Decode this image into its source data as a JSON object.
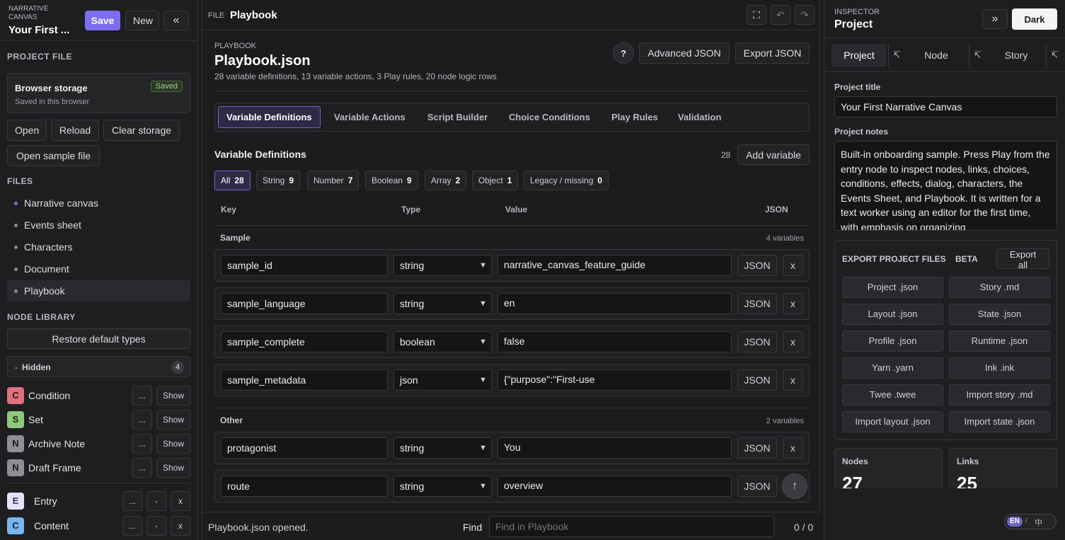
{
  "left": {
    "brand_sub": "NARRATIVE CANVAS",
    "brand_title": "Your First ...",
    "save_label": "Save",
    "new_label": "New",
    "collapse_glyph": "«",
    "project_file_title": "PROJECT FILE",
    "storage_title": "Browser storage",
    "storage_sub": "Saved in this browser",
    "saved_badge": "Saved",
    "open_label": "Open",
    "reload_label": "Reload",
    "clear_label": "Clear storage",
    "open_sample_label": "Open sample file",
    "files_title": "FILES",
    "files": [
      {
        "label": "Narrative canvas",
        "dot": "#7c6cf0"
      },
      {
        "label": "Events sheet",
        "dot": "#8a8a90"
      },
      {
        "label": "Characters",
        "dot": "#8a8a90"
      },
      {
        "label": "Document",
        "dot": "#8a8a90"
      },
      {
        "label": "Playbook",
        "dot": "#8a8a90"
      }
    ],
    "node_library_title": "NODE LIBRARY",
    "restore_label": "Restore default types",
    "hidden_label": "Hidden",
    "hidden_prefix": "-",
    "hidden_count": "4",
    "hidden_nodes": [
      {
        "letter": "C",
        "name": "Condition",
        "color": "#e0707a",
        "more": "...",
        "show": "Show"
      },
      {
        "letter": "S",
        "name": "Set",
        "color": "#8fc97f",
        "more": "...",
        "show": "Show"
      },
      {
        "letter": "N",
        "name": "Archive Note",
        "color": "#8e8e94",
        "more": "...",
        "show": "Show"
      },
      {
        "letter": "N",
        "name": "Draft Frame",
        "color": "#8e8e94",
        "more": "...",
        "show": "Show"
      }
    ],
    "visible_nodes": [
      {
        "letter": "E",
        "name": "Entry",
        "color": "#e4e2f6",
        "more": "...",
        "minus": "-",
        "x": "x"
      },
      {
        "letter": "C",
        "name": "Content",
        "color": "#7ab6ee",
        "more": "...",
        "minus": "-",
        "x": "x"
      }
    ]
  },
  "main": {
    "file_label": "FILE",
    "file_name": "Playbook",
    "fullscreen_glyph": "⛶",
    "undo_glyph": "↶",
    "redo_glyph": "↷",
    "section_label": "PLAYBOOK",
    "title": "Playbook.json",
    "summary": "28 variable definitions, 13 variable actions, 3 Play rules, 20 node logic rows",
    "help_label": "?",
    "advanced_json_label": "Advanced JSON",
    "export_json_label": "Export JSON",
    "tabs": [
      "Variable Definitions",
      "Variable Actions",
      "Script Builder",
      "Choice Conditions",
      "Play Rules",
      "Validation"
    ],
    "vd_title": "Variable Definitions",
    "vd_count": "28",
    "add_variable_label": "Add variable",
    "filters": [
      {
        "label": "All",
        "count": "28"
      },
      {
        "label": "String",
        "count": "9"
      },
      {
        "label": "Number",
        "count": "7"
      },
      {
        "label": "Boolean",
        "count": "9"
      },
      {
        "label": "Array",
        "count": "2"
      },
      {
        "label": "Object",
        "count": "1"
      },
      {
        "label": "Legacy / missing",
        "count": "0"
      }
    ],
    "headers": {
      "key": "Key",
      "type": "Type",
      "value": "Value",
      "json": "JSON"
    },
    "groups": [
      {
        "name": "Sample",
        "count": "4 variables"
      },
      {
        "name": "Other",
        "count": "2 variables"
      }
    ],
    "rows": [
      {
        "key": "sample_id",
        "type": "string",
        "value": "narrative_canvas_feature_guide",
        "json": "JSON",
        "x": "x"
      },
      {
        "key": "sample_language",
        "type": "string",
        "value": "en",
        "json": "JSON",
        "x": "x"
      },
      {
        "key": "sample_complete",
        "type": "boolean",
        "value": "false",
        "json": "JSON",
        "x": "x"
      },
      {
        "key": "sample_metadata",
        "type": "json",
        "value": "{\"purpose\":\"First-use",
        "json": "JSON",
        "x": "x"
      },
      {
        "key": "protagonist",
        "type": "string",
        "value": "You",
        "json": "JSON",
        "x": "x"
      },
      {
        "key": "route",
        "type": "string",
        "value": "overview",
        "json": "JSON",
        "x": "↑"
      }
    ],
    "status": "Playbook.json opened.",
    "find_label": "Find",
    "find_placeholder": "Find in Playbook",
    "find_count": "0 / 0"
  },
  "inspector": {
    "label": "INSPECTOR",
    "title": "Project",
    "expand_glyph": "»",
    "theme_label": "Dark",
    "tabs": [
      {
        "label": "Project",
        "pin": "↸"
      },
      {
        "label": "Node",
        "pin": "↸"
      },
      {
        "label": "Story",
        "pin": "↸"
      }
    ],
    "project_title_label": "Project title",
    "project_title_value": "Your First Narrative Canvas",
    "project_notes_label": "Project notes",
    "project_notes_value": "Built-in onboarding sample. Press Play from the entry node to inspect nodes, links, choices, conditions, effects, dialog, characters, the Events Sheet, and Playbook. It is written for a text worker using an editor for the first time, with emphasis on organizing",
    "export_title": "EXPORT PROJECT FILES",
    "beta_label": "BETA",
    "export_all_label": "Export all",
    "export_buttons": [
      "Project .json",
      "Story .md",
      "Layout .json",
      "State .json",
      "Profile .json",
      "Runtime .json",
      "Yarn .yarn",
      "Ink .ink",
      "Twee .twee",
      "Import story .md",
      "Import layout .json",
      "Import state .json"
    ],
    "stats": [
      {
        "label": "Nodes",
        "value": "27"
      },
      {
        "label": "Links",
        "value": "25"
      }
    ],
    "lang_en": "EN",
    "lang_sep": "/",
    "lang_zh": "中"
  }
}
